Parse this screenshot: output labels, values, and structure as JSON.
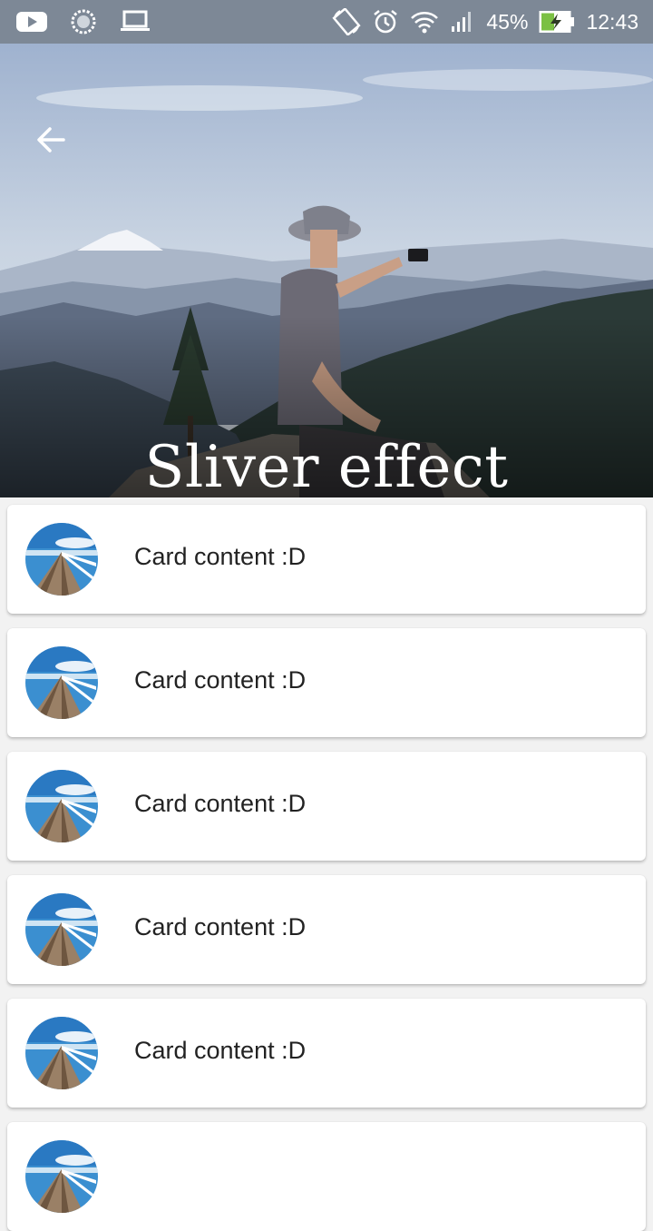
{
  "status_bar": {
    "battery_percent": "45%",
    "time": "12:43",
    "icons": [
      "youtube-icon",
      "loading-icon",
      "laptop-icon",
      "screen-rotation-icon",
      "alarm-icon",
      "wifi-icon",
      "signal-icon",
      "battery-charging-icon"
    ]
  },
  "header": {
    "title": "Sliver effect",
    "back_icon": "arrow-back-icon"
  },
  "list": {
    "items": [
      {
        "label": "Card content :D",
        "avatar": "pier-image"
      },
      {
        "label": "Card content :D",
        "avatar": "pier-image"
      },
      {
        "label": "Card content :D",
        "avatar": "pier-image"
      },
      {
        "label": "Card content :D",
        "avatar": "pier-image"
      },
      {
        "label": "Card content :D",
        "avatar": "pier-image"
      },
      {
        "label": "",
        "avatar": "pier-image"
      }
    ]
  }
}
